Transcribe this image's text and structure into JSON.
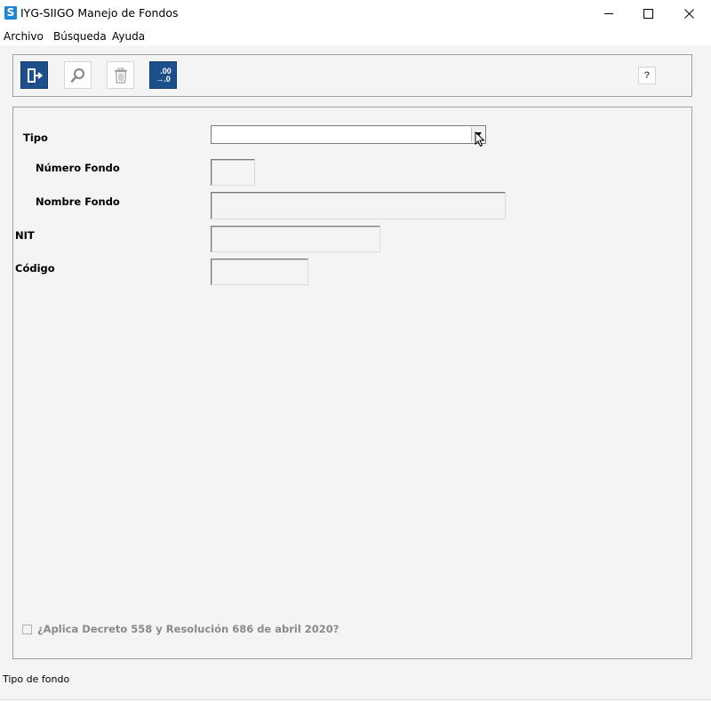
{
  "window": {
    "app_icon_letter": "S",
    "title": "IYG-SIIGO Manejo de Fondos"
  },
  "menu": {
    "items": [
      "Archivo",
      "Búsqueda",
      "Ayuda"
    ]
  },
  "toolbar": {
    "format_button_text_top": ".00",
    "format_button_text_bottom": "→.0",
    "help_label": "?"
  },
  "form": {
    "tipo_label": "Tipo",
    "tipo_value": "",
    "numero_label": "Número Fondo",
    "numero_value": "",
    "nombre_label": "Nombre Fondo",
    "nombre_value": "",
    "nit_label": "NIT",
    "nit_value": "",
    "codigo_label": "Código",
    "codigo_value": "",
    "checkbox_label": "¿Aplica Decreto 558 y Resolución 686 de abril 2020?",
    "checkbox_checked": false
  },
  "status": {
    "text": "Tipo de fondo"
  },
  "colors": {
    "toolbar_blue": "#1d4f8c",
    "app_icon": "#1f86d4",
    "panel_bg": "#f4f4f4"
  }
}
